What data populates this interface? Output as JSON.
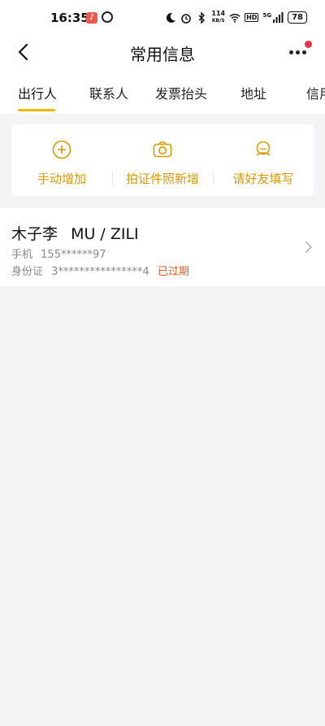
{
  "status_bar": {
    "time": "16:35",
    "network_speed": "114",
    "network_unit": "KB/S",
    "hd": "HD",
    "signal": "5G",
    "battery": "78"
  },
  "header": {
    "title": "常用信息"
  },
  "tabs": [
    {
      "label": "出行人",
      "active": true
    },
    {
      "label": "联系人",
      "active": false
    },
    {
      "label": "发票抬头",
      "active": false
    },
    {
      "label": "地址",
      "active": false
    },
    {
      "label": "信用",
      "active": false
    }
  ],
  "actions": [
    {
      "label": "手动增加",
      "icon": "plus-circle-icon"
    },
    {
      "label": "拍证件照新增",
      "icon": "camera-icon"
    },
    {
      "label": "请好友填写",
      "icon": "friend-icon"
    }
  ],
  "traveler": {
    "name": "木子李",
    "pinyin": "MU / ZILI",
    "phone_label": "手机",
    "phone": "155******97",
    "id_label": "身份证",
    "id_number": "3****************4",
    "id_status": "已过期"
  },
  "colors": {
    "accent": "#f2b705",
    "action_text": "#d79a00",
    "expired": "#e65a1e",
    "badge": "#e6334b"
  }
}
